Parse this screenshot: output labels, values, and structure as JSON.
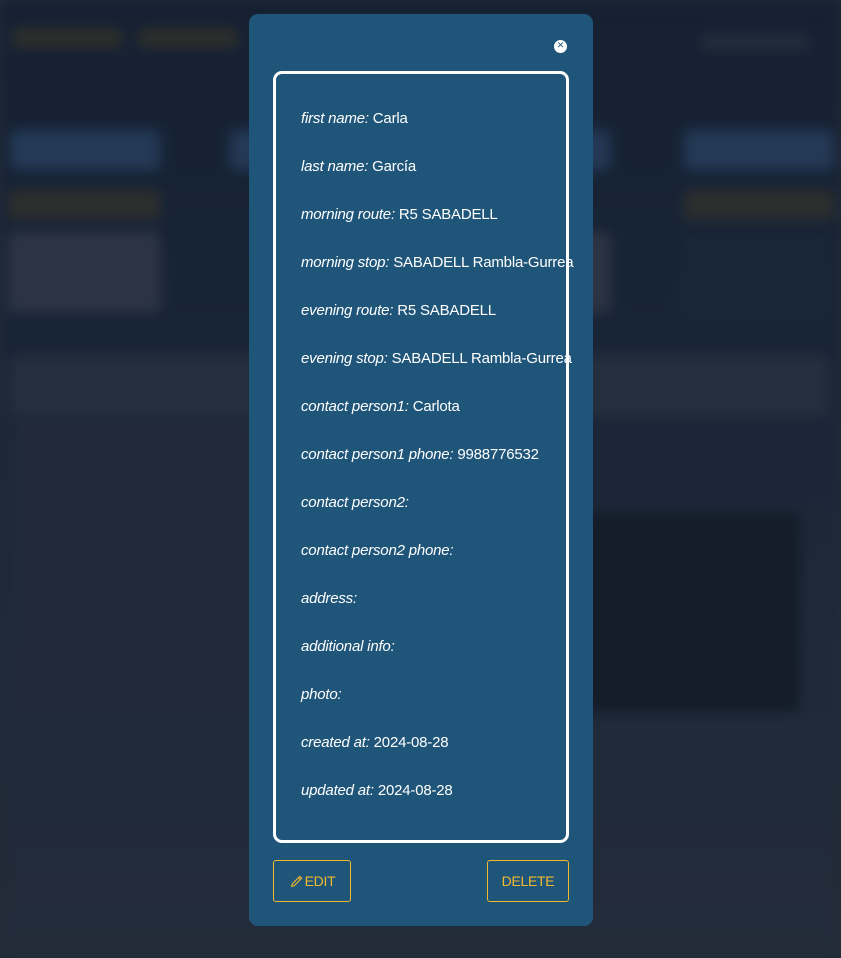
{
  "colors": {
    "modal_bg": "#20557a",
    "accent": "#f0b92e",
    "text": "#ffffff"
  },
  "modal": {
    "close_icon": "close-icon",
    "fields": [
      {
        "label": "first name:",
        "value": "Carla"
      },
      {
        "label": "last name:",
        "value": "García"
      },
      {
        "label": "morning route:",
        "value": "R5 SABADELL"
      },
      {
        "label": "morning stop:",
        "value": "SABADELL Rambla-Gurrea"
      },
      {
        "label": "evening route:",
        "value": "R5 SABADELL"
      },
      {
        "label": "evening stop:",
        "value": "SABADELL Rambla-Gurrea"
      },
      {
        "label": "contact person1:",
        "value": "Carlota"
      },
      {
        "label": "contact person1 phone:",
        "value": "9988776532"
      },
      {
        "label": "contact person2:",
        "value": ""
      },
      {
        "label": "contact person2 phone:",
        "value": ""
      },
      {
        "label": "address:",
        "value": ""
      },
      {
        "label": "additional info:",
        "value": ""
      },
      {
        "label": "photo:",
        "value": ""
      },
      {
        "label": "created at:",
        "value": "2024-08-28"
      },
      {
        "label": "updated at:",
        "value": "2024-08-28"
      }
    ],
    "edit_label": "EDIT",
    "edit_icon": "pencil-icon",
    "delete_label": "DELETE"
  }
}
